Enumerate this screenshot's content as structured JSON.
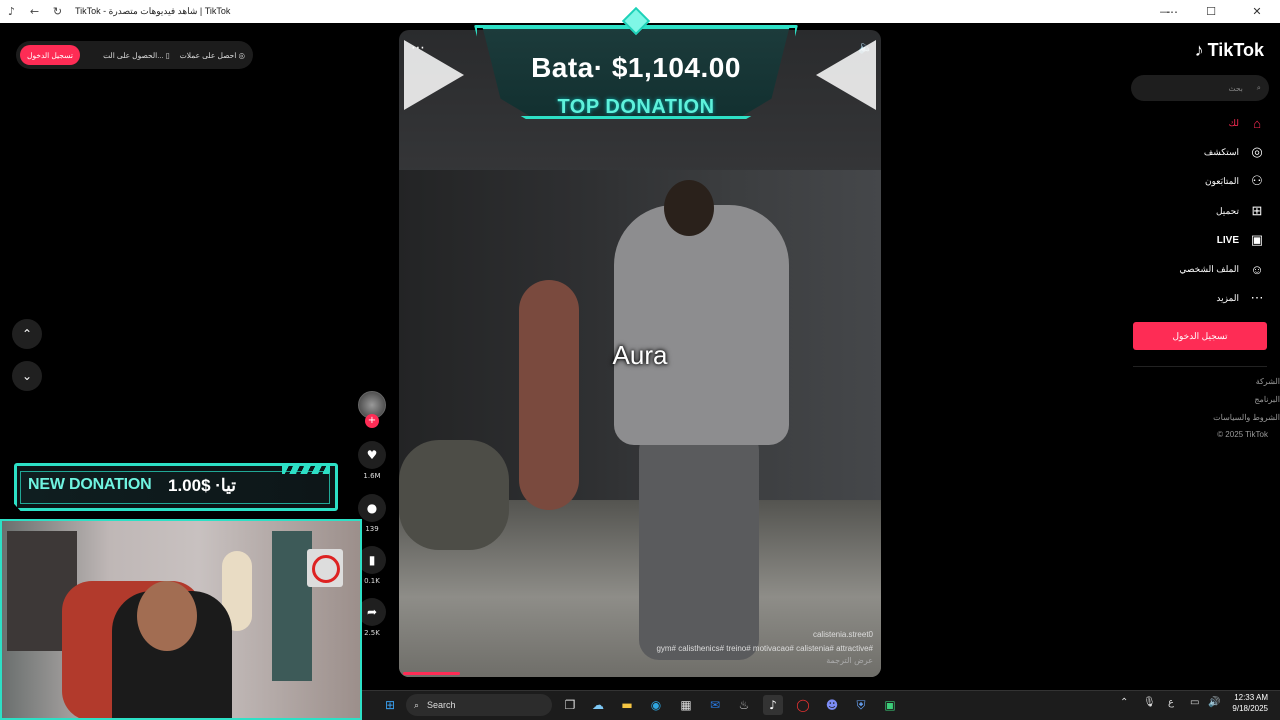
{
  "window": {
    "title": "TikTok - شاهد فيديوهات متصدرة | TikTok",
    "controls": {
      "minimize": "—",
      "maximize": "☐",
      "close": "✕"
    },
    "more": "⋯"
  },
  "top_pill": {
    "login_label": "تسجيل الدخول",
    "get_app_label": "الحصول على الت...",
    "get_coins_label": "احصل على عملات"
  },
  "nav_arrows": {
    "up": "⌃",
    "down": "⌄"
  },
  "overlay": {
    "top_donation_amount": "Bata· $1,104.00",
    "top_donation_label": "TOP DONATION",
    "new_donation_label": "NEW DONATION",
    "new_donation_amount": "تيا· $1.00"
  },
  "video": {
    "caption": "Aura",
    "username": "calistenia.street0",
    "hashtags": "gym# calisthenics# treino# motivacao# calistenia# attractive#",
    "translate": "عرض الترجمة",
    "progress": 0.12
  },
  "actions": {
    "likes": "1.6M",
    "comments": "139",
    "saves": "0.1K",
    "shares": "2.5K"
  },
  "sidebar": {
    "logo": "TikTok",
    "search_placeholder": "بحث",
    "items": [
      {
        "label": "لك",
        "icon": "home-icon",
        "active": true
      },
      {
        "label": "استكشف",
        "icon": "compass-icon"
      },
      {
        "label": "المتابَعون",
        "icon": "user-plus-icon"
      },
      {
        "label": "تحميل",
        "icon": "upload-icon"
      },
      {
        "label": "LIVE",
        "icon": "live-icon"
      },
      {
        "label": "الملف الشخصي",
        "icon": "profile-icon"
      },
      {
        "label": "المزيد",
        "icon": "more-icon"
      }
    ],
    "login_button": "تسجيل الدخول",
    "footer": [
      "الشركة",
      "البرنامج",
      "الشروط والسياسات",
      "© 2025 TikTok"
    ]
  },
  "taskbar": {
    "search_label": "Search",
    "time": "12:33 AM",
    "date": "9/18/2025",
    "lang": "ع"
  },
  "colors": {
    "accent": "#fe2c55",
    "overlay_teal": "#2de0c6"
  }
}
